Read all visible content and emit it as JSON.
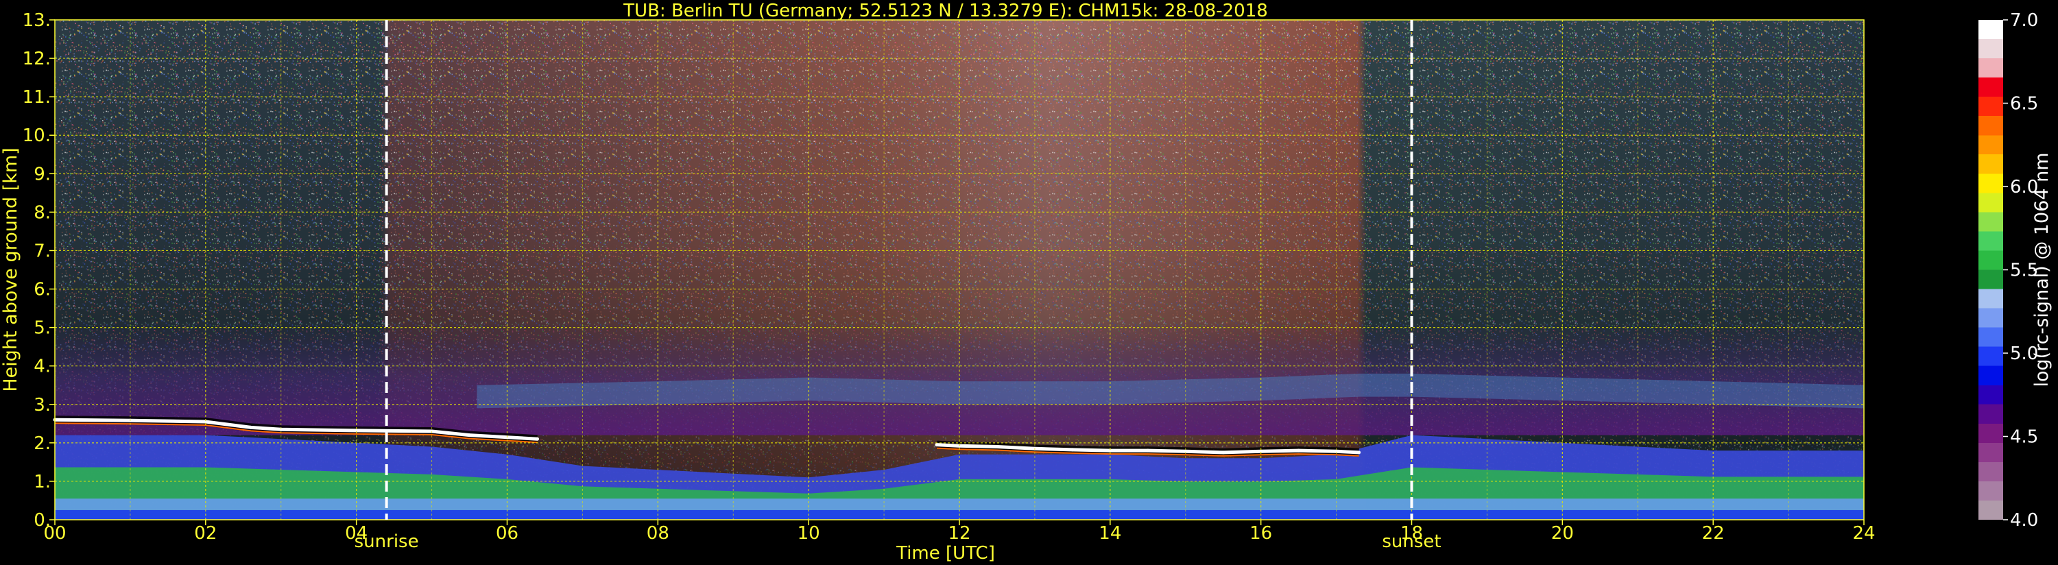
{
  "chart_data": {
    "type": "heatmap",
    "title": "TUB: Berlin TU (Germany; 52.5123 N / 13.3279 E):    CHM15k: 28-08-2018",
    "xlabel": "Time [UTC]",
    "ylabel": "Height above ground [km]",
    "xlim": [
      0,
      24
    ],
    "ylim": [
      0,
      13
    ],
    "x_ticks": [
      {
        "value": 0,
        "label": "00"
      },
      {
        "value": 2,
        "label": "02"
      },
      {
        "value": 4,
        "label": "04"
      },
      {
        "value": 6,
        "label": "06"
      },
      {
        "value": 8,
        "label": "08"
      },
      {
        "value": 10,
        "label": "10"
      },
      {
        "value": 12,
        "label": "12"
      },
      {
        "value": 14,
        "label": "14"
      },
      {
        "value": 16,
        "label": "16"
      },
      {
        "value": 18,
        "label": "18"
      },
      {
        "value": 20,
        "label": "20"
      },
      {
        "value": 22,
        "label": "22"
      },
      {
        "value": 24,
        "label": "24"
      }
    ],
    "y_ticks": [
      {
        "value": 0,
        "label": "0."
      },
      {
        "value": 1,
        "label": "1."
      },
      {
        "value": 2,
        "label": "2."
      },
      {
        "value": 3,
        "label": "3."
      },
      {
        "value": 4,
        "label": "4."
      },
      {
        "value": 5,
        "label": "5."
      },
      {
        "value": 6,
        "label": "6."
      },
      {
        "value": 7,
        "label": "7."
      },
      {
        "value": 8,
        "label": "8."
      },
      {
        "value": 9,
        "label": "9."
      },
      {
        "value": 10,
        "label": "10."
      },
      {
        "value": 11,
        "label": "11."
      },
      {
        "value": 12,
        "label": "12."
      },
      {
        "value": 13,
        "label": "13."
      }
    ],
    "grid": true,
    "grid_color": "#e6e600",
    "axes_color": "#ffff33",
    "annotations": [
      {
        "label": "sunrise",
        "x": 4.4
      },
      {
        "label": "sunset",
        "x": 18.0
      }
    ],
    "colorbar": {
      "label": "log(rc-signal) @ 1064 nm",
      "range": [
        4.0,
        7.0
      ],
      "ticks": [
        {
          "value": 4.0,
          "label": "4.0"
        },
        {
          "value": 4.5,
          "label": "4.5"
        },
        {
          "value": 5.0,
          "label": "5.0"
        },
        {
          "value": 5.5,
          "label": "5.5"
        },
        {
          "value": 6.0,
          "label": "6.0"
        },
        {
          "value": 6.5,
          "label": "6.5"
        },
        {
          "value": 7.0,
          "label": "7.0"
        }
      ],
      "colors": [
        "#b09aaa",
        "#a87ea4",
        "#9c5d98",
        "#8e3a8c",
        "#7a1a80",
        "#5a0a90",
        "#2a00b8",
        "#0010e8",
        "#1f3cf5",
        "#4a70f5",
        "#7a9cf2",
        "#a8c2f0",
        "#1e9a3a",
        "#2cbb44",
        "#48d060",
        "#8ee04a",
        "#d8f020",
        "#ffec00",
        "#ffc000",
        "#ff9400",
        "#ff6a00",
        "#ff2a0a",
        "#f00018",
        "#f0b0b8",
        "#ecd8dc",
        "#ffffff"
      ]
    },
    "series": [
      {
        "name": "cloud_layer",
        "x": [
          0.0,
          1.0,
          2.0,
          2.6,
          3.0,
          4.0,
          5.0,
          5.5,
          6.4
        ],
        "y": [
          2.6,
          2.58,
          2.55,
          2.4,
          2.35,
          2.32,
          2.3,
          2.2,
          2.1
        ]
      },
      {
        "name": "cloud_layer",
        "x": [
          11.7,
          12.0,
          12.5,
          13.0,
          13.5,
          14.0,
          14.5,
          15.0,
          15.5,
          16.0,
          16.5,
          17.0,
          17.3
        ],
        "y": [
          1.95,
          1.92,
          1.9,
          1.85,
          1.82,
          1.8,
          1.8,
          1.78,
          1.75,
          1.78,
          1.8,
          1.78,
          1.75
        ]
      },
      {
        "name": "boundary_layer_top",
        "x": [
          0,
          1,
          2,
          3,
          4,
          5,
          6,
          7,
          8,
          9,
          10,
          11,
          12,
          13,
          14,
          15,
          16,
          17,
          18,
          19,
          20,
          21,
          22,
          23,
          24
        ],
        "y": [
          2.2,
          2.2,
          2.2,
          2.1,
          2.0,
          1.9,
          1.7,
          1.4,
          1.3,
          1.2,
          1.1,
          1.3,
          1.7,
          1.7,
          1.7,
          1.6,
          1.6,
          1.7,
          2.2,
          2.1,
          2.0,
          1.9,
          1.8,
          1.8,
          1.8
        ]
      },
      {
        "name": "residual_layer",
        "x": [
          5.6,
          8,
          10,
          12,
          14,
          16,
          17.3,
          18,
          20,
          22,
          24
        ],
        "y": [
          3.5,
          3.6,
          3.7,
          3.6,
          3.6,
          3.7,
          3.8,
          3.8,
          3.7,
          3.6,
          3.5
        ]
      }
    ]
  }
}
